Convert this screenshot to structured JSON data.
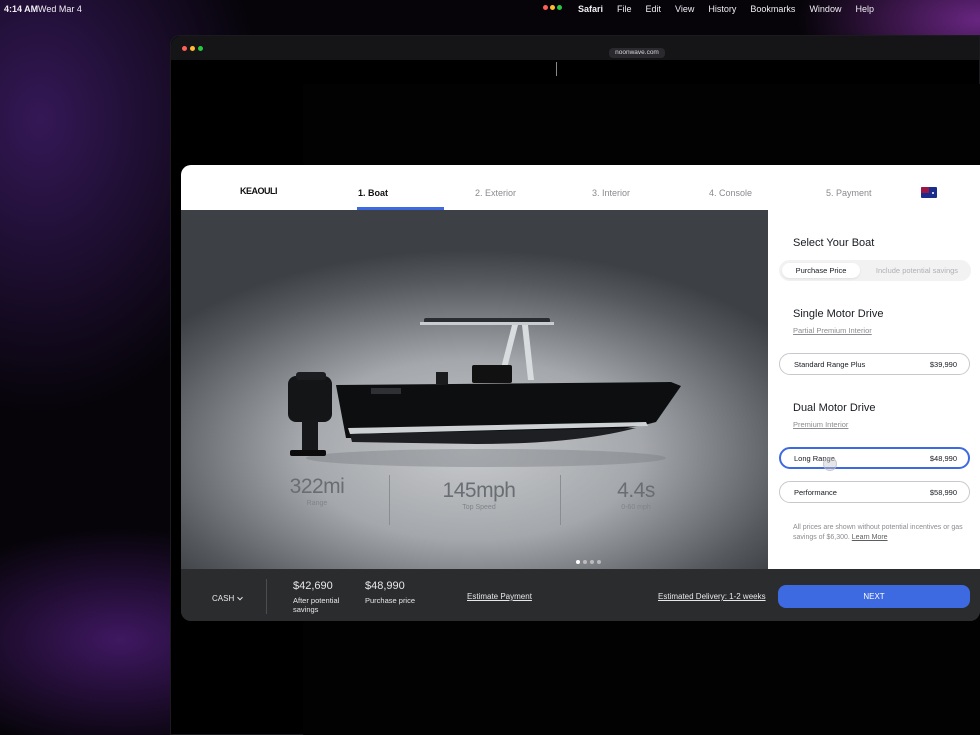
{
  "menubar": {
    "time": "4:14 AM",
    "date": "Wed Mar 4",
    "app": "Safari",
    "menus": [
      "File",
      "Edit",
      "View",
      "History",
      "Bookmarks",
      "Window",
      "Help"
    ]
  },
  "browser": {
    "url": "noonwave.com"
  },
  "configurator": {
    "logo": "KEAOULI",
    "steps": [
      "1. Boat",
      "2. Exterior",
      "3. Interior",
      "4. Console",
      "5. Payment"
    ],
    "active_step": 0,
    "stats": [
      {
        "value": "322mi",
        "label": "Range"
      },
      {
        "value": "145mph",
        "label": "Top Speed"
      },
      {
        "value": "4.4s",
        "label": "0-60 mph"
      }
    ],
    "carousel": {
      "count": 4,
      "active": 0
    },
    "panel": {
      "title": "Select Your Boat",
      "toggle": {
        "selected": "Purchase Price",
        "other": "Include potential savings"
      },
      "single": {
        "heading": "Single Motor Drive",
        "sub": "Partial Premium Interior",
        "options": [
          {
            "name": "Standard Range Plus",
            "price": "$39,990"
          }
        ]
      },
      "dual": {
        "heading": "Dual Motor Drive",
        "sub": "Premium Interior",
        "options": [
          {
            "name": "Long Range",
            "price": "$48,990"
          },
          {
            "name": "Performance",
            "price": "$58,990"
          }
        ]
      },
      "disclaimer": "All prices are shown without potential incentives or gas savings of $6,300.",
      "learn_more": "Learn More"
    },
    "footer": {
      "payment_type": "CASH",
      "after_savings_price": "$42,690",
      "after_savings_label": "After potential savings",
      "purchase_price": "$48,990",
      "purchase_label": "Purchase price",
      "estimate_link": "Estimate Payment",
      "delivery_link": "Estimated Delivery: 1-2 weeks",
      "next_label": "NEXT"
    },
    "colors": {
      "accent": "#3e6ae1",
      "footer": "#2b2c2e"
    }
  }
}
